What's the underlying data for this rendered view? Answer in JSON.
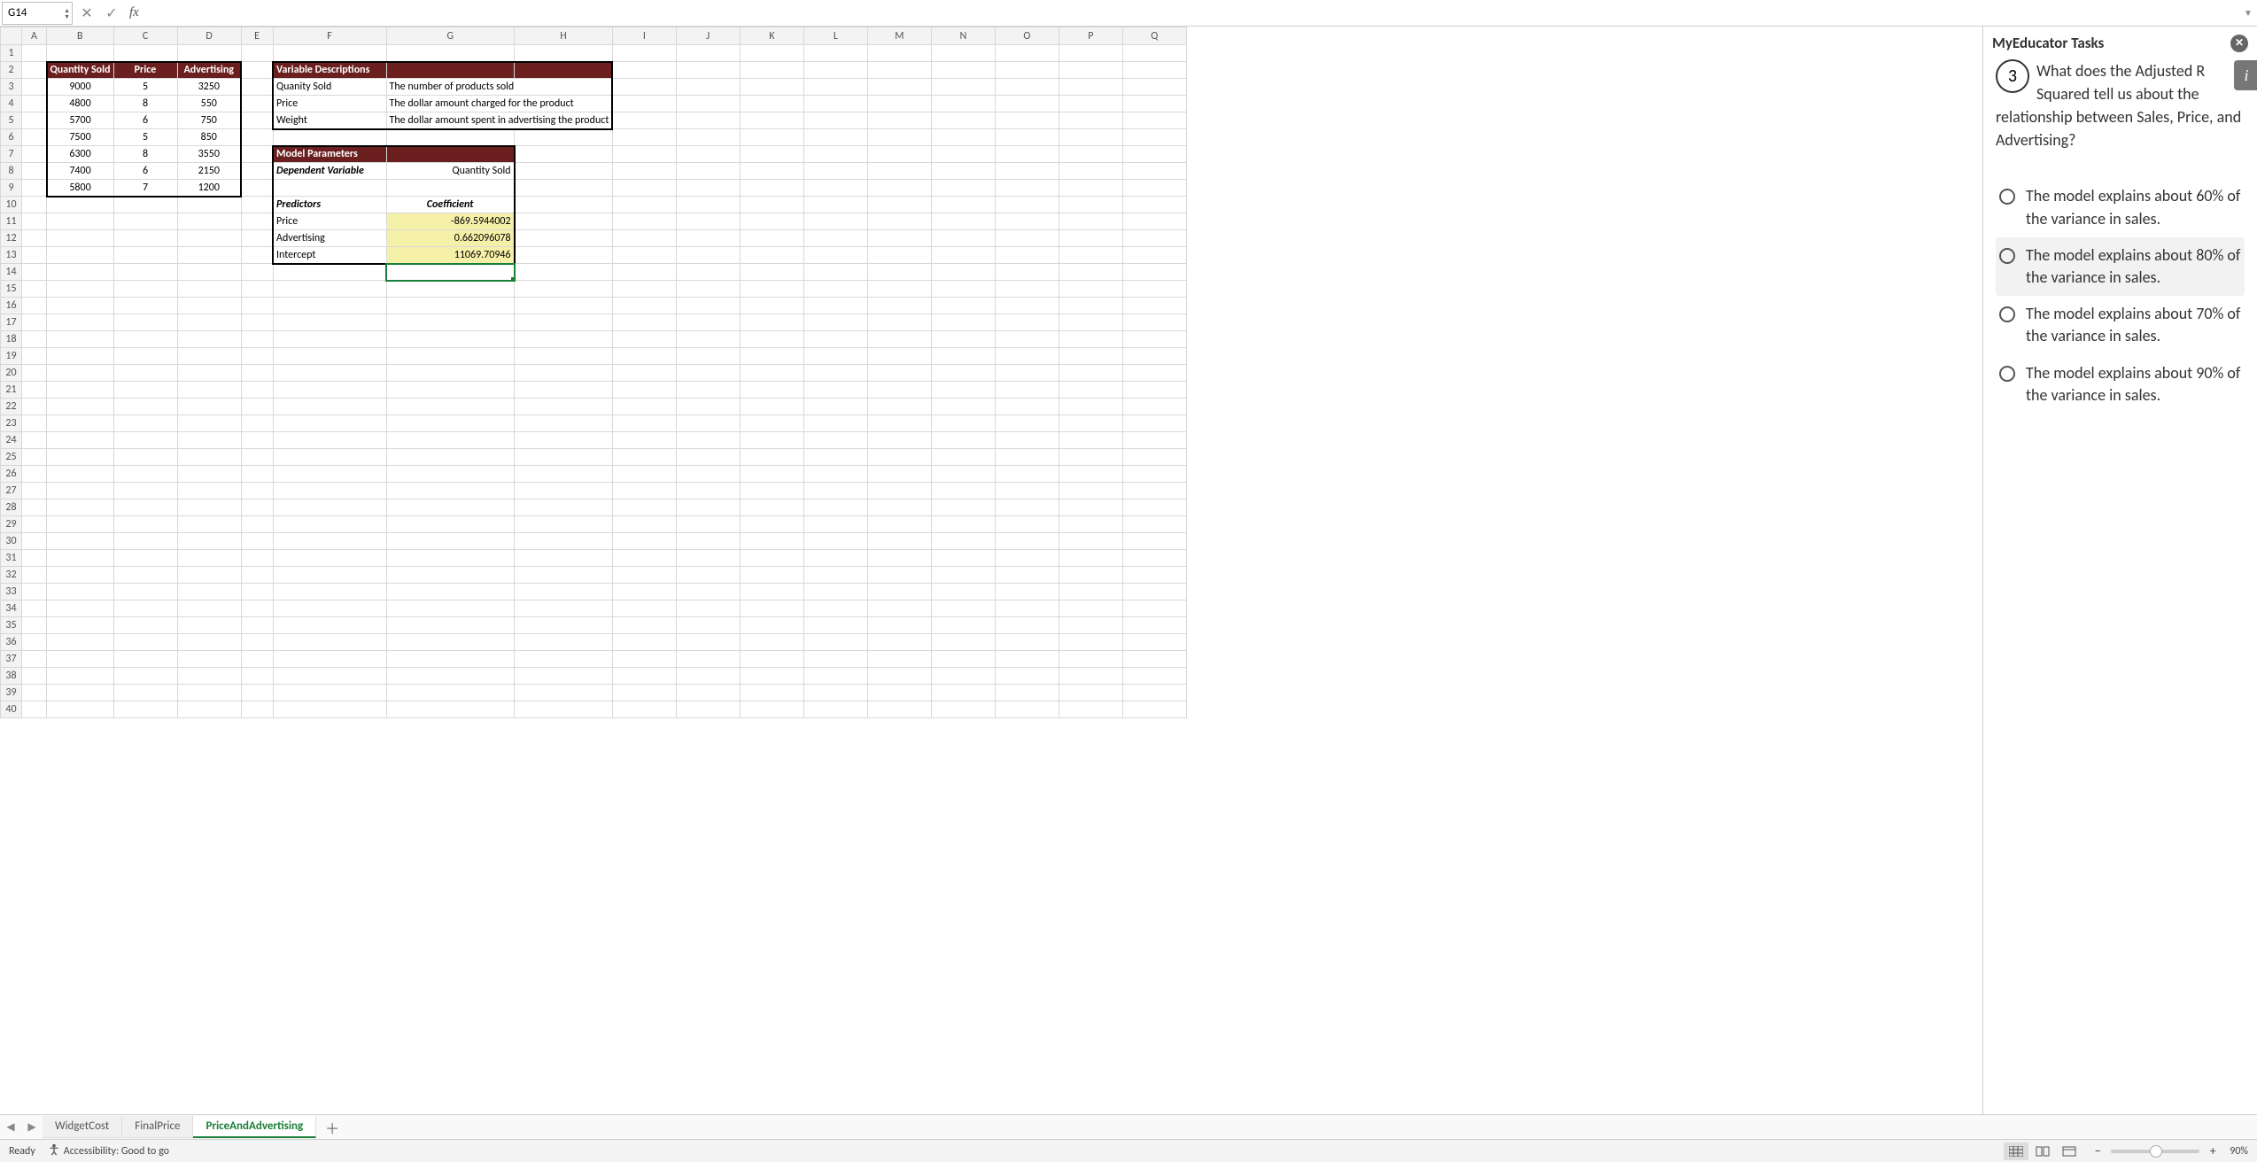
{
  "formula_bar": {
    "cell_ref": "G14",
    "formula": ""
  },
  "columns": [
    "A",
    "B",
    "C",
    "D",
    "E",
    "F",
    "G",
    "H",
    "I",
    "J",
    "K",
    "L",
    "M",
    "N",
    "O",
    "P",
    "Q"
  ],
  "row_count": 40,
  "table1": {
    "headers": [
      "Quantity Sold",
      "Price",
      "Advertising"
    ],
    "rows": [
      [
        "9000",
        "5",
        "3250"
      ],
      [
        "4800",
        "8",
        "550"
      ],
      [
        "5700",
        "6",
        "750"
      ],
      [
        "7500",
        "5",
        "850"
      ],
      [
        "6300",
        "8",
        "3550"
      ],
      [
        "7400",
        "6",
        "2150"
      ],
      [
        "5800",
        "7",
        "1200"
      ]
    ]
  },
  "var_desc": {
    "title": "Variable Descriptions",
    "rows": [
      [
        "Quanity Sold",
        "The number of products sold"
      ],
      [
        "Price",
        "The dollar amount charged for the product"
      ],
      [
        "Weight",
        "The dollar amount spent in advertising the product"
      ]
    ]
  },
  "model": {
    "title": "Model Parameters",
    "dep_label": "Dependent Variable",
    "dep_value": "Quantity Sold",
    "pred_label": "Predictors",
    "coef_label": "Coefficient",
    "rows": [
      [
        "Price",
        "-869.5944002"
      ],
      [
        "Advertising",
        "0.662096078"
      ],
      [
        "Intercept",
        "11069.70946"
      ]
    ]
  },
  "pane": {
    "title": "MyEducator Tasks",
    "qnum": "3",
    "question": "What does the Adjusted R Squared tell us about the relationship between Sales, Price, and Advertising?",
    "options": [
      "The model explains about 60% of the variance in sales.",
      "The model explains about 80% of the variance in sales.",
      "The model explains about 70% of the variance in sales.",
      "The model explains about 90% of the variance in sales."
    ],
    "highlight_index": 1
  },
  "tabs": [
    "WidgetCost",
    "FinalPrice",
    "PriceAndAdvertising"
  ],
  "active_tab": 2,
  "status": {
    "ready": "Ready",
    "accessibility": "Accessibility: Good to go",
    "zoom": "90%"
  },
  "selected_cell": "G14"
}
